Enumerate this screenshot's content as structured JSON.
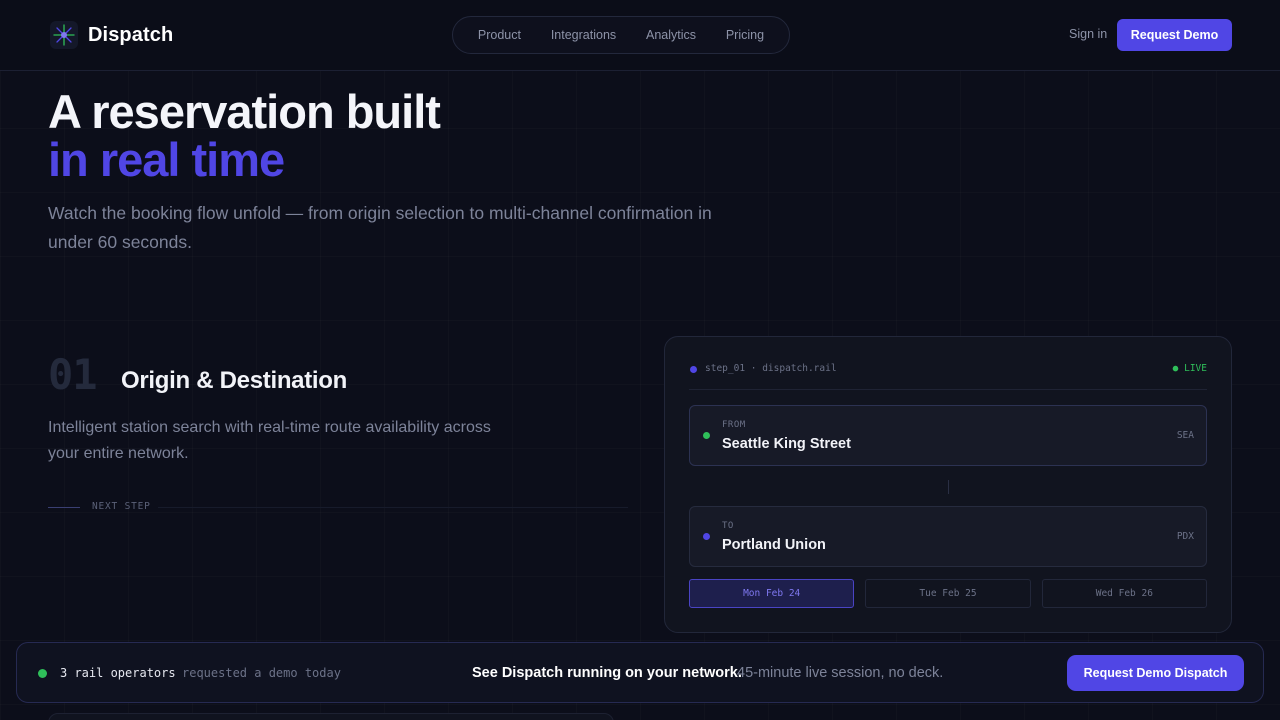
{
  "header": {
    "brand": "Dispatch",
    "logo_icon": "radial-spark-logo-icon",
    "nav": [
      "Product",
      "Integrations",
      "Analytics",
      "Pricing"
    ],
    "sign_in": "Sign in",
    "cta": "Request Demo"
  },
  "hero": {
    "line1": "A reservation built",
    "line2": "in real time",
    "subtitle": "Watch the booking flow unfold — from origin selection to multi-channel confirmation in under 60 seconds."
  },
  "step": {
    "number": "01",
    "title": "Origin & Destination",
    "description": "Intelligent station search with real-time route availability across your entire network.",
    "next_label": "NEXT STEP"
  },
  "card": {
    "meta": "step_01 · dispatch.rail",
    "status": "● LIVE",
    "from": {
      "label": "FROM",
      "station": "Seattle King Street",
      "code": "SEA"
    },
    "to": {
      "label": "TO",
      "station": "Portland Union",
      "code": "PDX"
    },
    "dates": [
      "Mon Feb 24",
      "Tue Feb 25",
      "Wed Feb 26"
    ],
    "selected_date": "Mon Feb 24"
  },
  "cta_bar": {
    "count": "3 rail operators",
    "count_suffix": "requested a demo today",
    "headline": "See Dispatch running on your network.",
    "detail": "45-minute live session, no deck.",
    "button": "Request Demo Dispatch"
  },
  "colors": {
    "accent": "#5046e5",
    "live": "#2fbf5a",
    "background": "#0c0e1a"
  }
}
